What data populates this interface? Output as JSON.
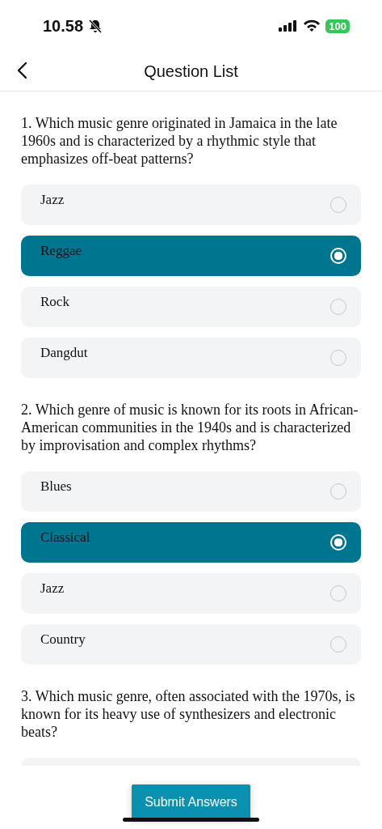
{
  "status_bar": {
    "time": "10.58",
    "battery": "100"
  },
  "header": {
    "title": "Question List"
  },
  "questions": [
    {
      "text": "1. Which music genre originated in Jamaica in the late 1960s and is characterized by a rhythmic style that emphasizes off-beat patterns?",
      "options": [
        {
          "label": "Jazz",
          "selected": false
        },
        {
          "label": "Reggae",
          "selected": true
        },
        {
          "label": "Rock",
          "selected": false
        },
        {
          "label": "Dangdut",
          "selected": false
        }
      ]
    },
    {
      "text": "2. Which genre of music is known for its roots in African-American communities in the 1940s and is characterized by improvisation and complex rhythms?",
      "options": [
        {
          "label": "Blues",
          "selected": false
        },
        {
          "label": "Classical",
          "selected": true
        },
        {
          "label": "Jazz",
          "selected": false
        },
        {
          "label": "Country",
          "selected": false
        }
      ]
    },
    {
      "text": "3. Which music genre, often associated with the 1970s, is known for its heavy use of synthesizers and electronic beats?",
      "options": [
        {
          "selected": false
        }
      ]
    }
  ],
  "submit_button": "Submit Answers"
}
